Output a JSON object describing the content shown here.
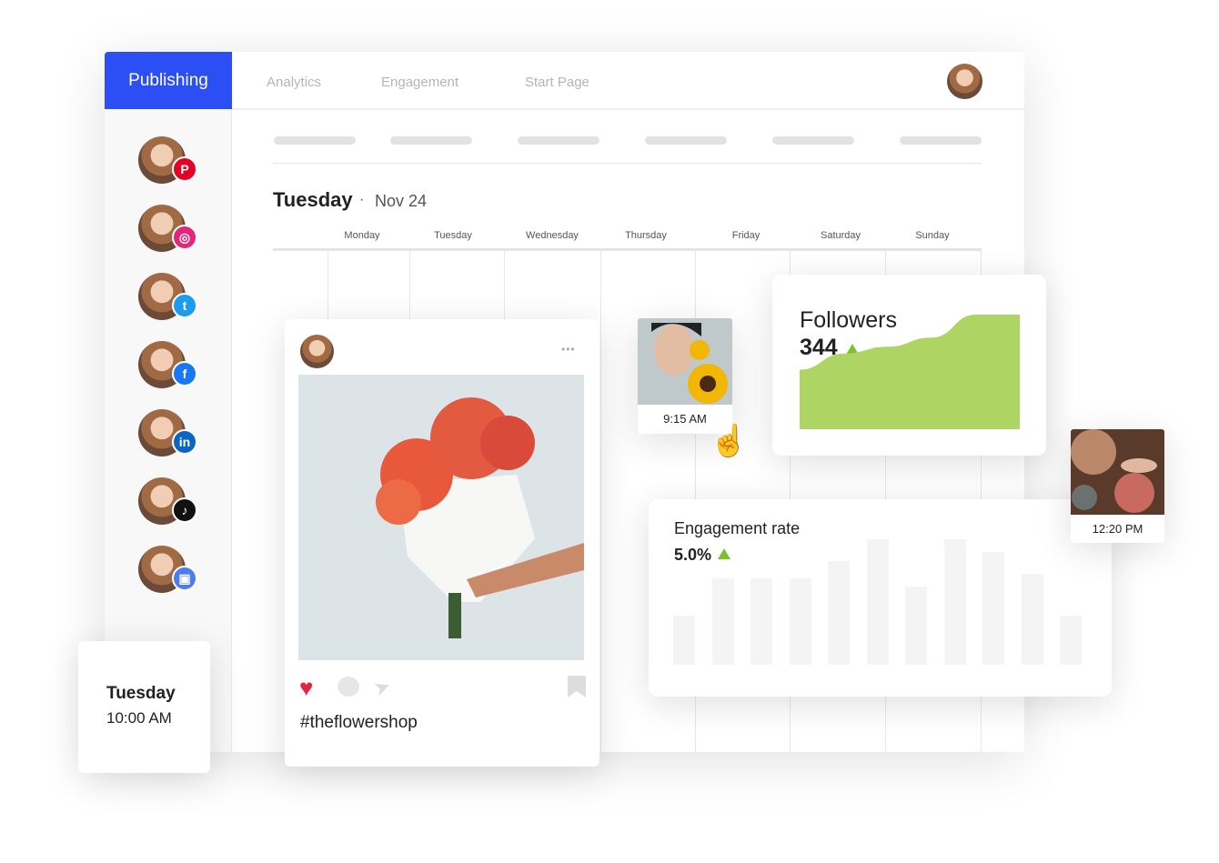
{
  "nav": {
    "tabs": [
      {
        "label": "Publishing",
        "active": true
      },
      {
        "label": "Analytics"
      },
      {
        "label": "Engagement"
      },
      {
        "label": "Start Page"
      }
    ]
  },
  "colors": {
    "accent": "#2b4ff5",
    "growth": "#aed563",
    "up_arrow": "#7cc22b"
  },
  "sidebar": {
    "channels": [
      {
        "network": "pinterest",
        "icon": "pinterest-icon",
        "color": "#e60023",
        "glyph": "P"
      },
      {
        "network": "instagram",
        "icon": "instagram-icon",
        "color": "#e4257a",
        "glyph": "◎"
      },
      {
        "network": "twitter",
        "icon": "twitter-icon",
        "color": "#1d9bf0",
        "glyph": "t"
      },
      {
        "network": "facebook",
        "icon": "facebook-icon",
        "color": "#1877f2",
        "glyph": "f"
      },
      {
        "network": "linkedin",
        "icon": "linkedin-icon",
        "color": "#0a66c2",
        "glyph": "in"
      },
      {
        "network": "tiktok",
        "icon": "tiktok-icon",
        "color": "#111111",
        "glyph": "♪"
      },
      {
        "network": "google-business",
        "icon": "store-icon",
        "color": "#4c7cf0",
        "glyph": "▣"
      }
    ]
  },
  "calendar": {
    "day": "Tuesday",
    "date": "Nov 24",
    "separator": "·",
    "weekdays": [
      "Monday",
      "Tuesday",
      "Wednesday",
      "Thursday",
      "Friday",
      "Saturday",
      "Sunday"
    ]
  },
  "post": {
    "hashtag": "#theflowershop",
    "more": "•••"
  },
  "scheduled": [
    {
      "time": "9:15 AM"
    },
    {
      "time": "12:20 PM"
    }
  ],
  "followers": {
    "title": "Followers",
    "value": "344",
    "trend": "up"
  },
  "engagement": {
    "title": "Engagement rate",
    "value": "5.0%",
    "trend": "up"
  },
  "time_card": {
    "day": "Tuesday",
    "time": "10:00 AM"
  },
  "chart_data": [
    {
      "type": "area",
      "title": "Followers",
      "trend": "rising",
      "values": [
        0.52,
        0.66,
        0.72,
        0.8,
        1.0,
        1.0
      ]
    },
    {
      "type": "bar",
      "title": "Engagement rate",
      "values": [
        54,
        95,
        95,
        95,
        114,
        138,
        86,
        138,
        124,
        100,
        54
      ]
    }
  ]
}
